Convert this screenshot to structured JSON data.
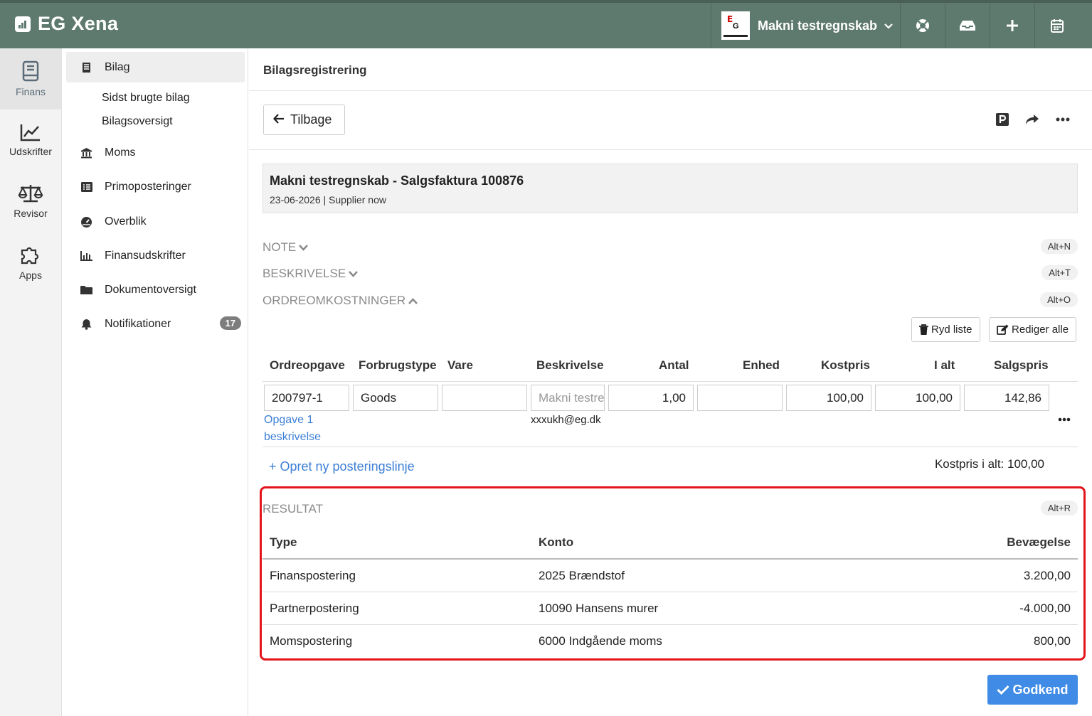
{
  "app": {
    "name": "EG Xena"
  },
  "topbar": {
    "company": "Makni testregnskab"
  },
  "rail": [
    {
      "label": "Finans",
      "icon": "book-icon",
      "active": true
    },
    {
      "label": "Udskrifter",
      "icon": "line-chart-icon"
    },
    {
      "label": "Revisor",
      "icon": "scale-icon"
    },
    {
      "label": "Apps",
      "icon": "puzzle-icon"
    }
  ],
  "subnav": {
    "bilag": "Bilag",
    "sidst_brugte": "Sidst brugte bilag",
    "bilagsoversigt": "Bilagsoversigt",
    "moms": "Moms",
    "primoposteringer": "Primoposteringer",
    "overblik": "Overblik",
    "finansudskrifter": "Finansudskrifter",
    "dokumentoversigt": "Dokumentoversigt",
    "notifikationer": "Notifikationer",
    "notif_count": "17"
  },
  "page": {
    "title": "Bilagsregistrering",
    "back_label": "Tilbage"
  },
  "header": {
    "title": "Makni testregnskab - Salgsfaktura 100876",
    "subtitle": "23-06-2026 | Supplier now"
  },
  "sections": {
    "note": "NOTE",
    "note_key": "Alt+N",
    "beskrivelse": "BESKRIVELSE",
    "beskrivelse_key": "Alt+T",
    "ordre": "ORDREOMKOSTNINGER",
    "ordre_key": "Alt+O",
    "resultat": "RESULTAT",
    "resultat_key": "Alt+R"
  },
  "buttons": {
    "ryd": "Ryd liste",
    "rediger": "Rediger alle",
    "godkend": "Godkend"
  },
  "order_table": {
    "headers": [
      "Ordreopgave",
      "Forbrugstype",
      "Vare",
      "Beskrivelse",
      "Antal",
      "Enhed",
      "Kostpris",
      "I alt",
      "Salgspris"
    ],
    "row": {
      "ordreopgave": "200797-1",
      "forbrugstype": "Goods",
      "vare": "",
      "beskrivelse_placeholder": "Makni testregnskab",
      "antal": "1,00",
      "enhed": "",
      "kostpris": "100,00",
      "i_alt": "100,00",
      "salgspris": "142,86",
      "task_link": "Opgave 1",
      "task_link2": "beskrivelse",
      "email": "xxxukh@eg.dk"
    },
    "new_line": "+ Opret ny posteringslinje",
    "kostpris_total": "Kostpris i alt: 100,00"
  },
  "result_table": {
    "headers": [
      "Type",
      "Konto",
      "Bevægelse"
    ],
    "rows": [
      {
        "type": "Finanspostering",
        "konto": "2025 Brændstof",
        "bevaegelse": "3.200,00"
      },
      {
        "type": "Partnerpostering",
        "konto": "10090 Hansens murer",
        "bevaegelse": "-4.000,00"
      },
      {
        "type": "Momspostering",
        "konto": "6000 Indgående moms",
        "bevaegelse": "800,00"
      }
    ]
  },
  "colors": {
    "topbar": "#5e7a6f",
    "accent": "#3f8be6",
    "highlight": "#e4141b",
    "link": "#3d7fd6"
  }
}
